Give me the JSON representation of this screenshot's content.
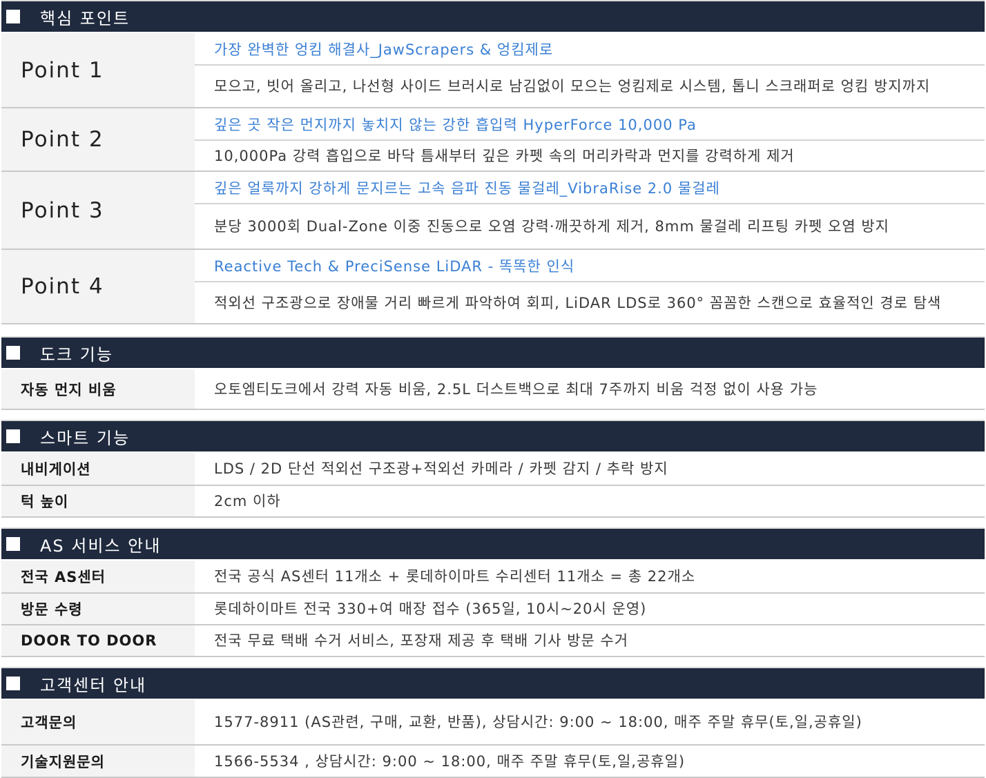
{
  "colors": {
    "header_bg": "#1f2a3e",
    "headline": "#3a7fd4",
    "body_text": "#3a3a3a",
    "label_text": "#1a1a1a",
    "label_bg": "#f3f3f3",
    "divider": "#c9c9c9"
  },
  "section_icon": "square-icon",
  "key_points": {
    "title": "핵심 포인트",
    "rows": [
      {
        "label": "Point 1",
        "headline": "가장 완벽한 엉킴 해결사_JawScrapers & 엉킴제로",
        "desc": "모으고, 빗어 올리고, 나선형 사이드 브러시로 남김없이 모으는 엉킴제로 시스템, 톱니 스크래퍼로 엉킴 방지까지"
      },
      {
        "label": "Point 2",
        "headline": "깊은 곳 작은 먼지까지 놓치지 않는 강한 흡입력 HyperForce 10,000 Pa",
        "desc": "10,000Pa 강력 흡입으로 바닥 틈새부터 깊은 카펫 속의 머리카락과 먼지를 강력하게 제거"
      },
      {
        "label": "Point 3",
        "headline": "깊은 얼룩까지 강하게 문지르는 고속 음파 진동 물걸레_VibraRise 2.0 물걸레",
        "desc": "분당 3000회 Dual-Zone 이중 진동으로 오염 강력·깨끗하게 제거, 8mm 물걸레 리프팅 카펫 오염 방지"
      },
      {
        "label": "Point 4",
        "headline": "Reactive Tech & PreciSense LiDAR - 똑똑한 인식",
        "desc": "적외선 구조광으로 장애물 거리 빠르게 파악하여 회피, LiDAR LDS로 360° 꼼꼼한 스캔으로 효율적인 경로 탐색"
      }
    ]
  },
  "dock": {
    "title": "도크 기능",
    "rows": [
      {
        "label": "자동 먼지 비움",
        "value": "오토엠티도크에서 강력 자동 비움, 2.5L 더스트백으로 최대 7주까지 비움 걱정 없이 사용 가능"
      }
    ]
  },
  "smart": {
    "title": "스마트 기능",
    "rows": [
      {
        "label": "내비게이션",
        "value": "LDS / 2D 단선 적외선 구조광+적외선 카메라 / 카펫 감지 / 추락 방지"
      },
      {
        "label": "턱 높이",
        "value": "2cm 이하"
      }
    ]
  },
  "as_service": {
    "title": "AS 서비스 안내",
    "rows": [
      {
        "label": "전국 AS센터",
        "value": "전국 공식 AS센터 11개소 + 롯데하이마트 수리센터 11개소 = 총 22개소"
      },
      {
        "label": "방문 수령",
        "value": "롯데하이마트 전국 330+여 매장 접수 (365일, 10시~20시 운영)"
      },
      {
        "label": "DOOR TO DOOR",
        "value": "전국 무료 택배 수거 서비스, 포장재 제공 후 택배 기사 방문 수거"
      }
    ]
  },
  "customer_center": {
    "title": "고객센터 안내",
    "rows": [
      {
        "label": "고객문의",
        "value": "1577-8911 (AS관련, 구매, 교환, 반품), 상담시간: 9:00 ~ 18:00, 매주 주말 휴무(토,일,공휴일)"
      },
      {
        "label": "기술지원문의",
        "value": "1566-5534 , 상담시간: 9:00 ~ 18:00, 매주 주말 휴무(토,일,공휴일)"
      }
    ]
  }
}
